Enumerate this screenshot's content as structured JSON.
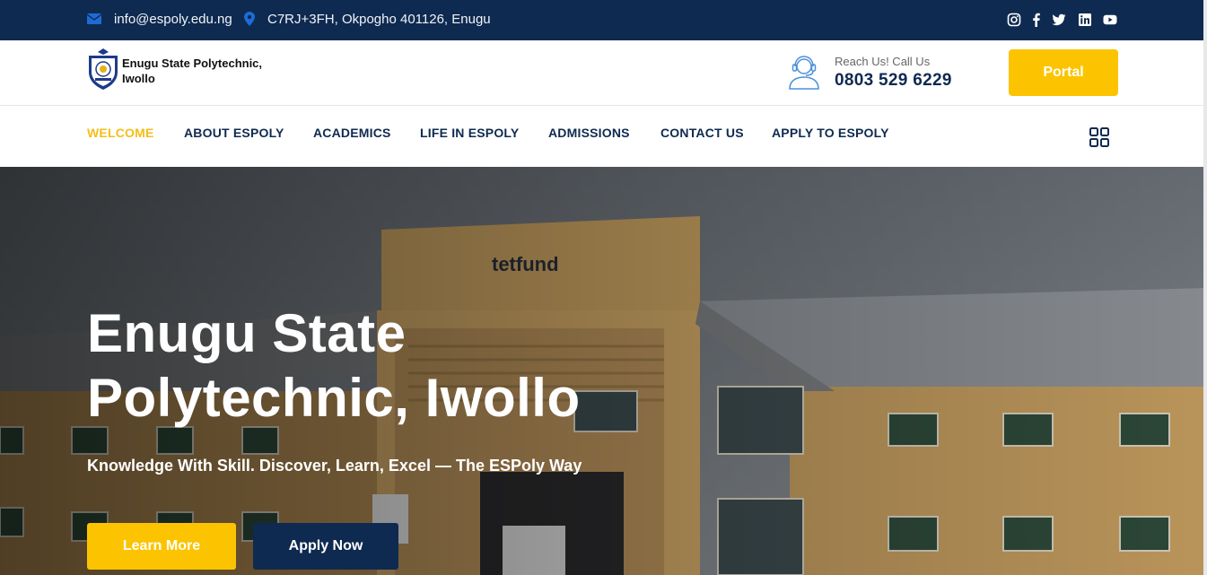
{
  "topbar": {
    "email": "info@espoly.edu.ng",
    "address": "C7RJ+3FH, Okpogho 401126, Enugu",
    "social_icons": [
      "instagram-icon",
      "facebook-icon",
      "twitter-icon",
      "linkedin-icon",
      "youtube-icon"
    ]
  },
  "header": {
    "logo_text": "Enugu State Polytechnic, Iwollo",
    "reach_label": "Reach Us! Call Us",
    "phone": "0803 529 6229",
    "portal_label": "Portal"
  },
  "nav": {
    "items": [
      {
        "label": "WELCOME",
        "active": true
      },
      {
        "label": "ABOUT ESPOLY",
        "active": false
      },
      {
        "label": "ACADEMICS",
        "active": false
      },
      {
        "label": "LIFE IN ESPOLY",
        "active": false
      },
      {
        "label": "ADMISSIONS",
        "active": false
      },
      {
        "label": "CONTACT US",
        "active": false
      },
      {
        "label": "APPLY TO ESPOLY",
        "active": false
      }
    ]
  },
  "hero": {
    "title": "Enugu State Polytechnic, Iwollo",
    "subtitle": "Knowledge With Skill. Discover, Learn, Excel — The ESPoly Way",
    "learn_more_label": "Learn More",
    "apply_now_label": "Apply Now",
    "building_sign": "tetfund"
  },
  "colors": {
    "navy": "#0f2a50",
    "yellow": "#fcc400",
    "active_nav": "#f6be1b"
  }
}
